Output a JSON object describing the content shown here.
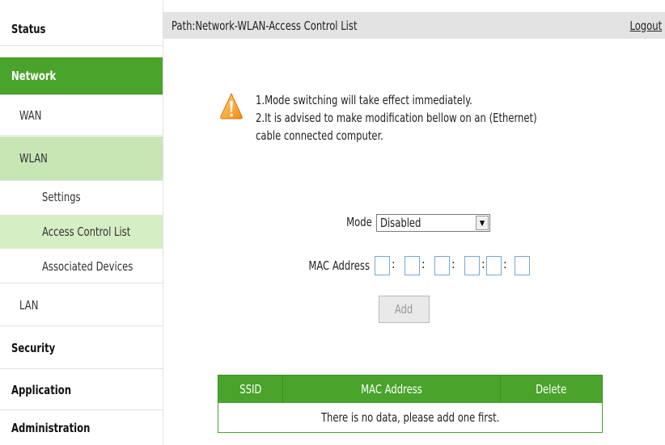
{
  "sidebar": {
    "status": "Status",
    "network": "Network",
    "wan": "WAN",
    "wlan": "WLAN",
    "settings": "Settings",
    "access_control_list": "Access Control List",
    "associated_devices": "Associated Devices",
    "lan": "LAN",
    "security": "Security",
    "application": "Application",
    "administration": "Administration"
  },
  "header": {
    "path": "Path:Network-WLAN-Access Control List",
    "logout": "Logout"
  },
  "notes": {
    "line1": "1.Mode switching will take effect immediately.",
    "line2": "2.It is advised to make modification bellow on an (Ethernet)",
    "line3": "cable connected computer."
  },
  "form": {
    "mode_label": "Mode",
    "mode_value": "Disabled",
    "mac_label": "MAC Address",
    "add_label": "Add"
  },
  "table": {
    "headers": [
      "SSID",
      "MAC Address",
      "Delete"
    ],
    "empty_text": "There is no data, please add one first."
  },
  "colors": {
    "accent": "#4aa32b",
    "active_sub": "#c8e6b4",
    "header_bg": "#e3e3e3"
  }
}
